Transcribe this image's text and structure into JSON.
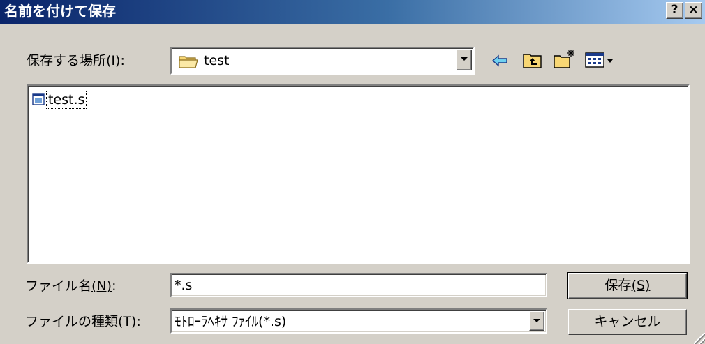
{
  "window": {
    "title": "名前を付けて保存",
    "help_label": "?",
    "close_label": "×"
  },
  "location": {
    "label": "保存する場所",
    "hotkey": "(I)",
    "suffix": ":",
    "value": "test"
  },
  "toolbar": {
    "back_icon": "back-arrow-icon",
    "up_icon": "up-folder-icon",
    "new_folder_icon": "new-folder-icon",
    "view_menu_icon": "view-menu-icon"
  },
  "file_list": {
    "items": [
      {
        "name": "test.s",
        "icon": "file-icon"
      }
    ]
  },
  "filename": {
    "label": "ファイル名",
    "hotkey": "(N)",
    "suffix": ":",
    "value": "*.s"
  },
  "filetype": {
    "label": "ファイルの種類",
    "hotkey": "(T)",
    "suffix": ":",
    "value": "ﾓﾄﾛｰﾗﾍｷｻ ﾌｧｲﾙ(*.s)"
  },
  "buttons": {
    "save": "保存",
    "save_hotkey": "(S)",
    "cancel": "キャンセル"
  },
  "colors": {
    "title_gradient_start": "#0a246a",
    "title_gradient_end": "#a6caf0",
    "face": "#d4d0c8"
  }
}
